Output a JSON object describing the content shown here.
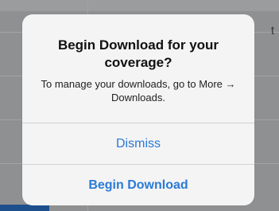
{
  "background": {
    "peek_text": "t"
  },
  "alert": {
    "title": "Begin Download for your coverage?",
    "message": "To manage your downloads, go to More → Downloads.",
    "buttons": {
      "dismiss_label": "Dismiss",
      "begin_label": "Begin Download"
    },
    "colors": {
      "accent": "#2a7ad6",
      "background": "#f4f4f4"
    }
  }
}
